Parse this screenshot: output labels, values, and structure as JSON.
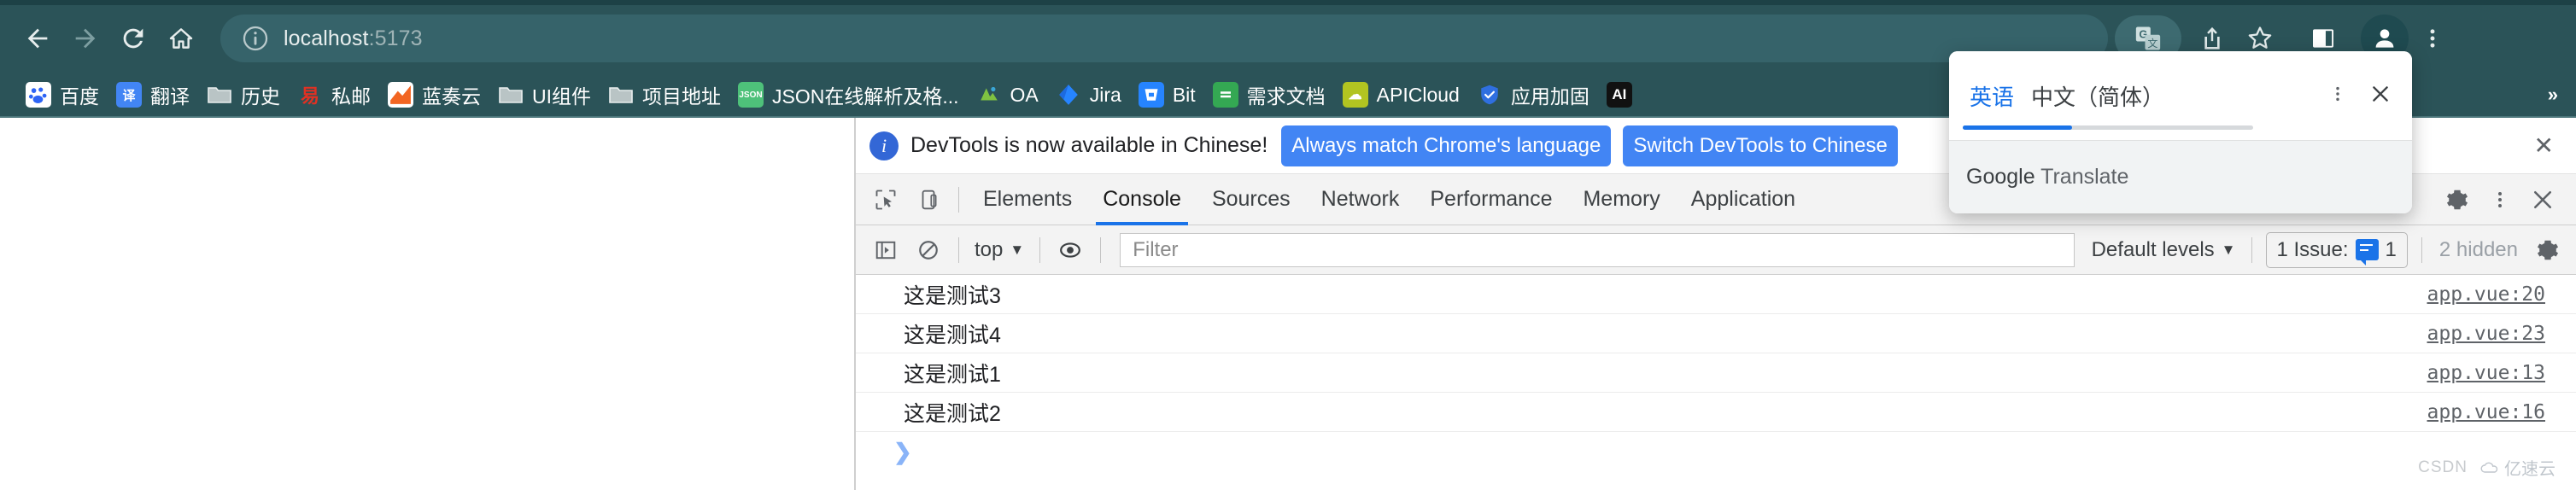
{
  "browser": {
    "nav": {
      "back_label": "Back",
      "forward_label": "Forward",
      "reload_label": "Reload",
      "home_label": "Home"
    },
    "omnibox": {
      "url_host": "localhost",
      "url_port": ":5173",
      "full_url": "localhost:5173",
      "info_icon": "info-circle-icon"
    },
    "toolbar_icons": [
      "translate-icon",
      "share-icon",
      "bookmark-star-icon",
      "side-panel-icon",
      "profile-avatar-icon",
      "chrome-menu-icon"
    ],
    "theme_color": "#2b5358"
  },
  "bookmarks": {
    "overflow_label": "»",
    "items": [
      {
        "label": "百度",
        "icon": "baidu-paw-icon",
        "icon_bg": "#ffffff",
        "icon_fg": "#2d64f5",
        "glyph": "✺"
      },
      {
        "label": "翻译",
        "icon": "translate-icon",
        "icon_bg": "#4285f4",
        "icon_fg": "#ffffff",
        "glyph": "译"
      },
      {
        "label": "历史",
        "icon": "folder-icon",
        "icon_bg": "transparent",
        "icon_fg": "#cfd8d9",
        "glyph": ""
      },
      {
        "label": "私邮",
        "icon": "netease-mail-icon",
        "icon_bg": "transparent",
        "icon_fg": "#e03123",
        "glyph": "易"
      },
      {
        "label": "蓝奏云",
        "icon": "lanzou-icon",
        "icon_bg": "#ffffff",
        "icon_fg": "#f26522",
        "glyph": ""
      },
      {
        "label": "UI组件",
        "icon": "folder-icon",
        "icon_bg": "transparent",
        "icon_fg": "#cfd8d9",
        "glyph": ""
      },
      {
        "label": "项目地址",
        "icon": "folder-icon",
        "icon_bg": "transparent",
        "icon_fg": "#cfd8d9",
        "glyph": ""
      },
      {
        "label": "JSON在线解析及格...",
        "icon": "json-icon",
        "icon_bg": "#4ec17a",
        "icon_fg": "#ffffff",
        "glyph": "J"
      },
      {
        "label": "OA",
        "icon": "oa-icon",
        "icon_bg": "transparent",
        "icon_fg": "#7fc241",
        "glyph": "✿"
      },
      {
        "label": "Jira",
        "icon": "jira-icon",
        "icon_bg": "transparent",
        "icon_fg": "#2684ff",
        "glyph": "◆"
      },
      {
        "label": "Bit",
        "icon": "bitbucket-icon",
        "icon_bg": "#2684ff",
        "icon_fg": "#ffffff",
        "glyph": "▽"
      },
      {
        "label": "需求文档",
        "icon": "sheets-icon",
        "icon_bg": "#34a853",
        "icon_fg": "#ffffff",
        "glyph": "≡"
      },
      {
        "label": "APICloud",
        "icon": "apicloud-icon",
        "icon_bg": "#b2c421",
        "icon_fg": "#ffffff",
        "glyph": "☁"
      },
      {
        "label": "应用加固",
        "icon": "shield-icon",
        "icon_bg": "transparent",
        "icon_fg": "#2f6fe0",
        "glyph": "⛊"
      },
      {
        "label": "AI",
        "icon": "ai-icon",
        "icon_bg": "#111111",
        "icon_fg": "#ffffff",
        "glyph": "AI"
      }
    ]
  },
  "google_translate_popup": {
    "tabs": [
      {
        "label": "英语",
        "selected": true
      },
      {
        "label": "中文（简体）",
        "selected": false
      }
    ],
    "menu_icon": "more-vertical-icon",
    "close_icon": "close-icon",
    "brand_prefix": "Google",
    "brand_suffix": " Translate",
    "progress_percent": 38
  },
  "devtools": {
    "banner": {
      "info_icon": "info-icon",
      "message": "DevTools is now available in Chinese!",
      "primary_button": "Always match Chrome's language",
      "secondary_button": "Switch DevTools to Chinese",
      "close_icon": "close-icon"
    },
    "tabbar": {
      "inspect_icon": "inspect-element-icon",
      "device_icon": "device-toolbar-icon",
      "tabs": [
        {
          "label": "Elements",
          "active": false
        },
        {
          "label": "Console",
          "active": true
        },
        {
          "label": "Sources",
          "active": false
        },
        {
          "label": "Network",
          "active": false
        },
        {
          "label": "Performance",
          "active": false
        },
        {
          "label": "Memory",
          "active": false
        },
        {
          "label": "Application",
          "active": false
        }
      ],
      "settings_icon": "gear-icon",
      "more_icon": "more-vertical-icon",
      "close_icon": "close-icon"
    },
    "toolbar": {
      "sidebar_icon": "console-sidebar-icon",
      "clear_icon": "clear-console-icon",
      "context": "top",
      "context_caret": "▼",
      "eye_icon": "live-expression-icon",
      "filter_placeholder": "Filter",
      "filter_value": "",
      "levels_label": "Default levels",
      "levels_caret": "▼",
      "issue_label": "1 Issue:",
      "issue_count": "1",
      "hidden_label": "2 hidden",
      "settings_icon": "gear-icon"
    },
    "console": {
      "rows": [
        {
          "message": "这是测试3",
          "source": "app.vue:20"
        },
        {
          "message": "这是测试4",
          "source": "app.vue:23"
        },
        {
          "message": "这是测试1",
          "source": "app.vue:13"
        },
        {
          "message": "这是测试2",
          "source": "app.vue:16"
        }
      ],
      "prompt_caret": "❯"
    }
  },
  "watermark": {
    "left_text": "CSDN",
    "right_text": "亿速云",
    "cloud_icon": "cloud-icon"
  }
}
